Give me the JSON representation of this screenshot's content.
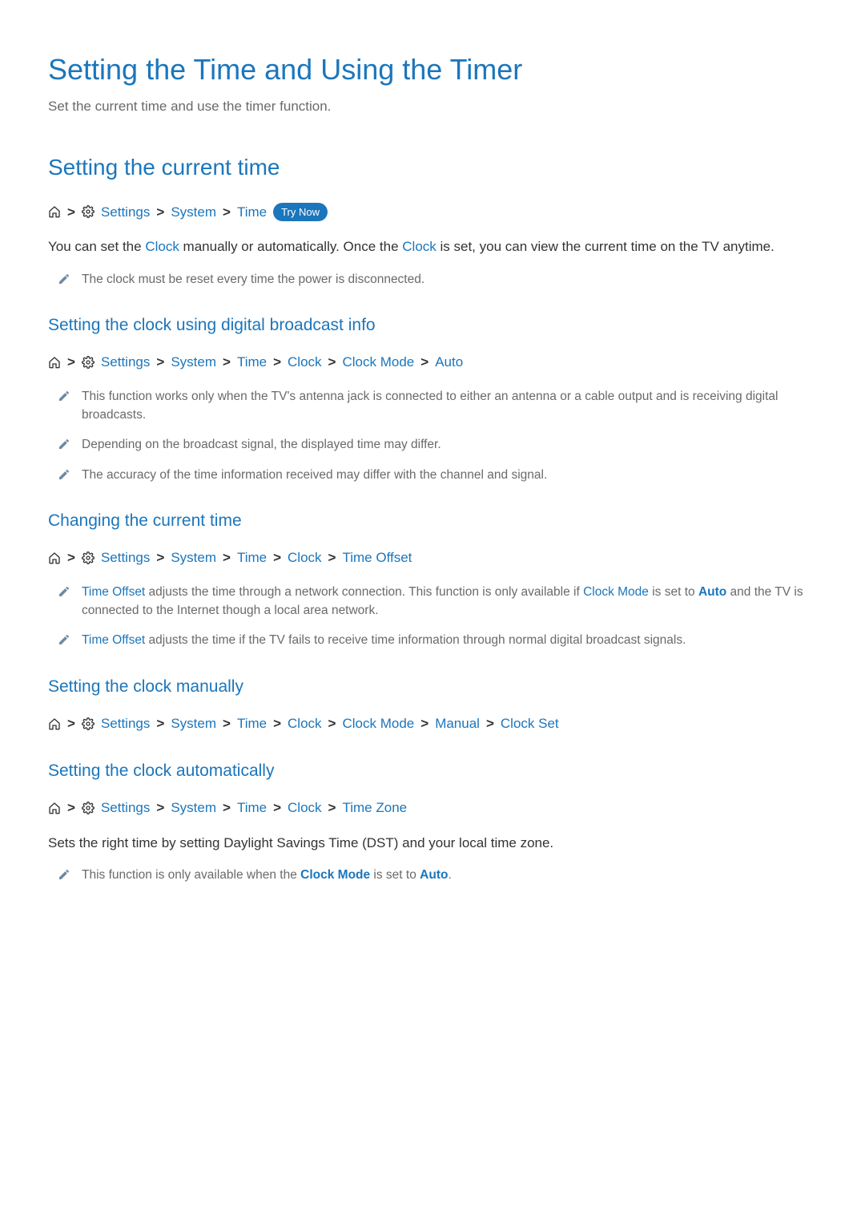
{
  "title": "Setting the Time and Using the Timer",
  "subtitle": "Set the current time and use the timer function.",
  "section1_heading": "Setting the current time",
  "path1_settings": "Settings",
  "path1_system": "System",
  "path1_time": "Time",
  "try_now": "Try Now",
  "body1_pre": "You can set the ",
  "body1_clock": "Clock",
  "body1_mid": " manually or automatically. Once the ",
  "body1_post": " is set, you can view the current time on the TV anytime.",
  "note1": "The clock must be reset every time the power is disconnected.",
  "section2_heading": "Setting the clock using digital broadcast info",
  "path2_clock": "Clock",
  "path2_clockmode": "Clock Mode",
  "path2_auto": "Auto",
  "note2a": "This function works only when the TV's antenna jack is connected to either an antenna or a cable output and is receiving digital broadcasts.",
  "note2b": "Depending on the broadcast signal, the displayed time may differ.",
  "note2c": "The accuracy of the time information received may differ with the channel and signal.",
  "section3_heading": "Changing the current time",
  "path3_timeoffset": "Time Offset",
  "note3a_pre": " adjusts the time through a network connection. This function is only available if ",
  "note3a_mid": " is set to ",
  "note3a_post": " and the TV is connected to the Internet though a local area network.",
  "note3b_post": " adjusts the time if the TV fails to receive time information through normal digital broadcast signals.",
  "section4_heading": "Setting the clock manually",
  "path4_manual": "Manual",
  "path4_clockset": "Clock Set",
  "section5_heading": "Setting the clock automatically",
  "path5_timezone": "Time Zone",
  "body5": "Sets the right time by setting Daylight Savings Time (DST) and your local time zone.",
  "note5_pre": "This function is only available when the ",
  "note5_post": " is set to ",
  "note5_end": "."
}
